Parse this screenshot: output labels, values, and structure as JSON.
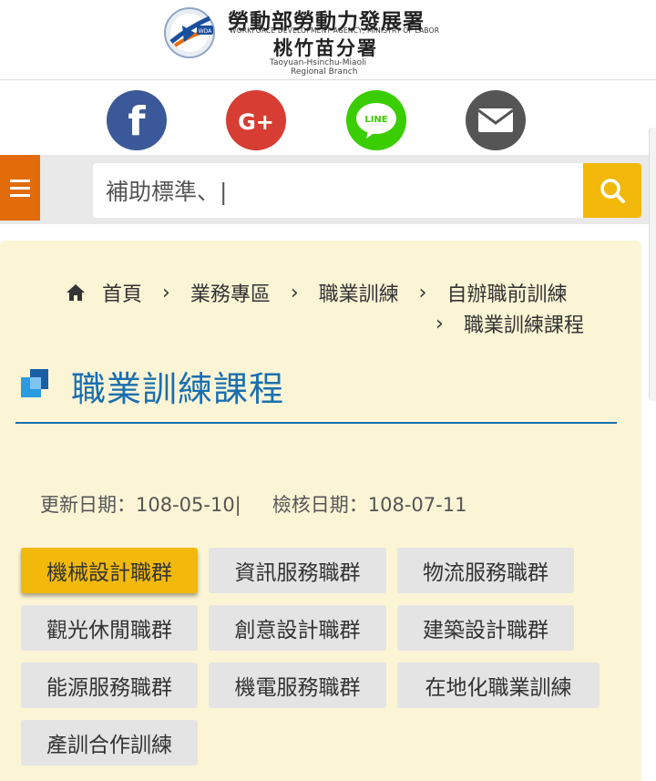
{
  "header": {
    "agency_cn": "勞動部勞動力發展署",
    "agency_en": "WORKFORCE DEVELOPMENT AGENCY, MINISTRY OF LABOR",
    "branch_cn": "桃竹苗分署",
    "branch_en_line1": "Taoyuan-Hsinchu-Miaoli",
    "branch_en_line2": "Regional Branch",
    "logo_badge": "WDA"
  },
  "social": {
    "facebook": {
      "glyph": "f",
      "color": "#3b5998"
    },
    "googleplus": {
      "glyph": "G+",
      "color": "#d73d32"
    },
    "line": {
      "glyph": "LINE",
      "color": "#3acd01"
    },
    "email": {
      "color": "#555555"
    }
  },
  "search": {
    "value": "補助標準、|",
    "accent": "#f2b90c",
    "menu_color": "#e26b0a"
  },
  "breadcrumb": {
    "home": "首頁",
    "items": [
      "業務專區",
      "職業訓練",
      "自辦職前訓練",
      "職業訓練課程"
    ],
    "separator": "›"
  },
  "page": {
    "title": "職業訓練課程",
    "updated": "更新日期：108-05-10|",
    "reviewed": "檢核日期：108-07-11"
  },
  "categories": [
    {
      "label": "機械設計職群",
      "active": true
    },
    {
      "label": "資訊服務職群",
      "active": false
    },
    {
      "label": "物流服務職群",
      "active": false
    },
    {
      "label": "觀光休閒職群",
      "active": false
    },
    {
      "label": "創意設計職群",
      "active": false
    },
    {
      "label": "建築設計職群",
      "active": false
    },
    {
      "label": "能源服務職群",
      "active": false
    },
    {
      "label": "機電服務職群",
      "active": false
    },
    {
      "label": "在地化職業訓練",
      "active": false
    },
    {
      "label": "產訓合作訓練",
      "active": false
    }
  ]
}
